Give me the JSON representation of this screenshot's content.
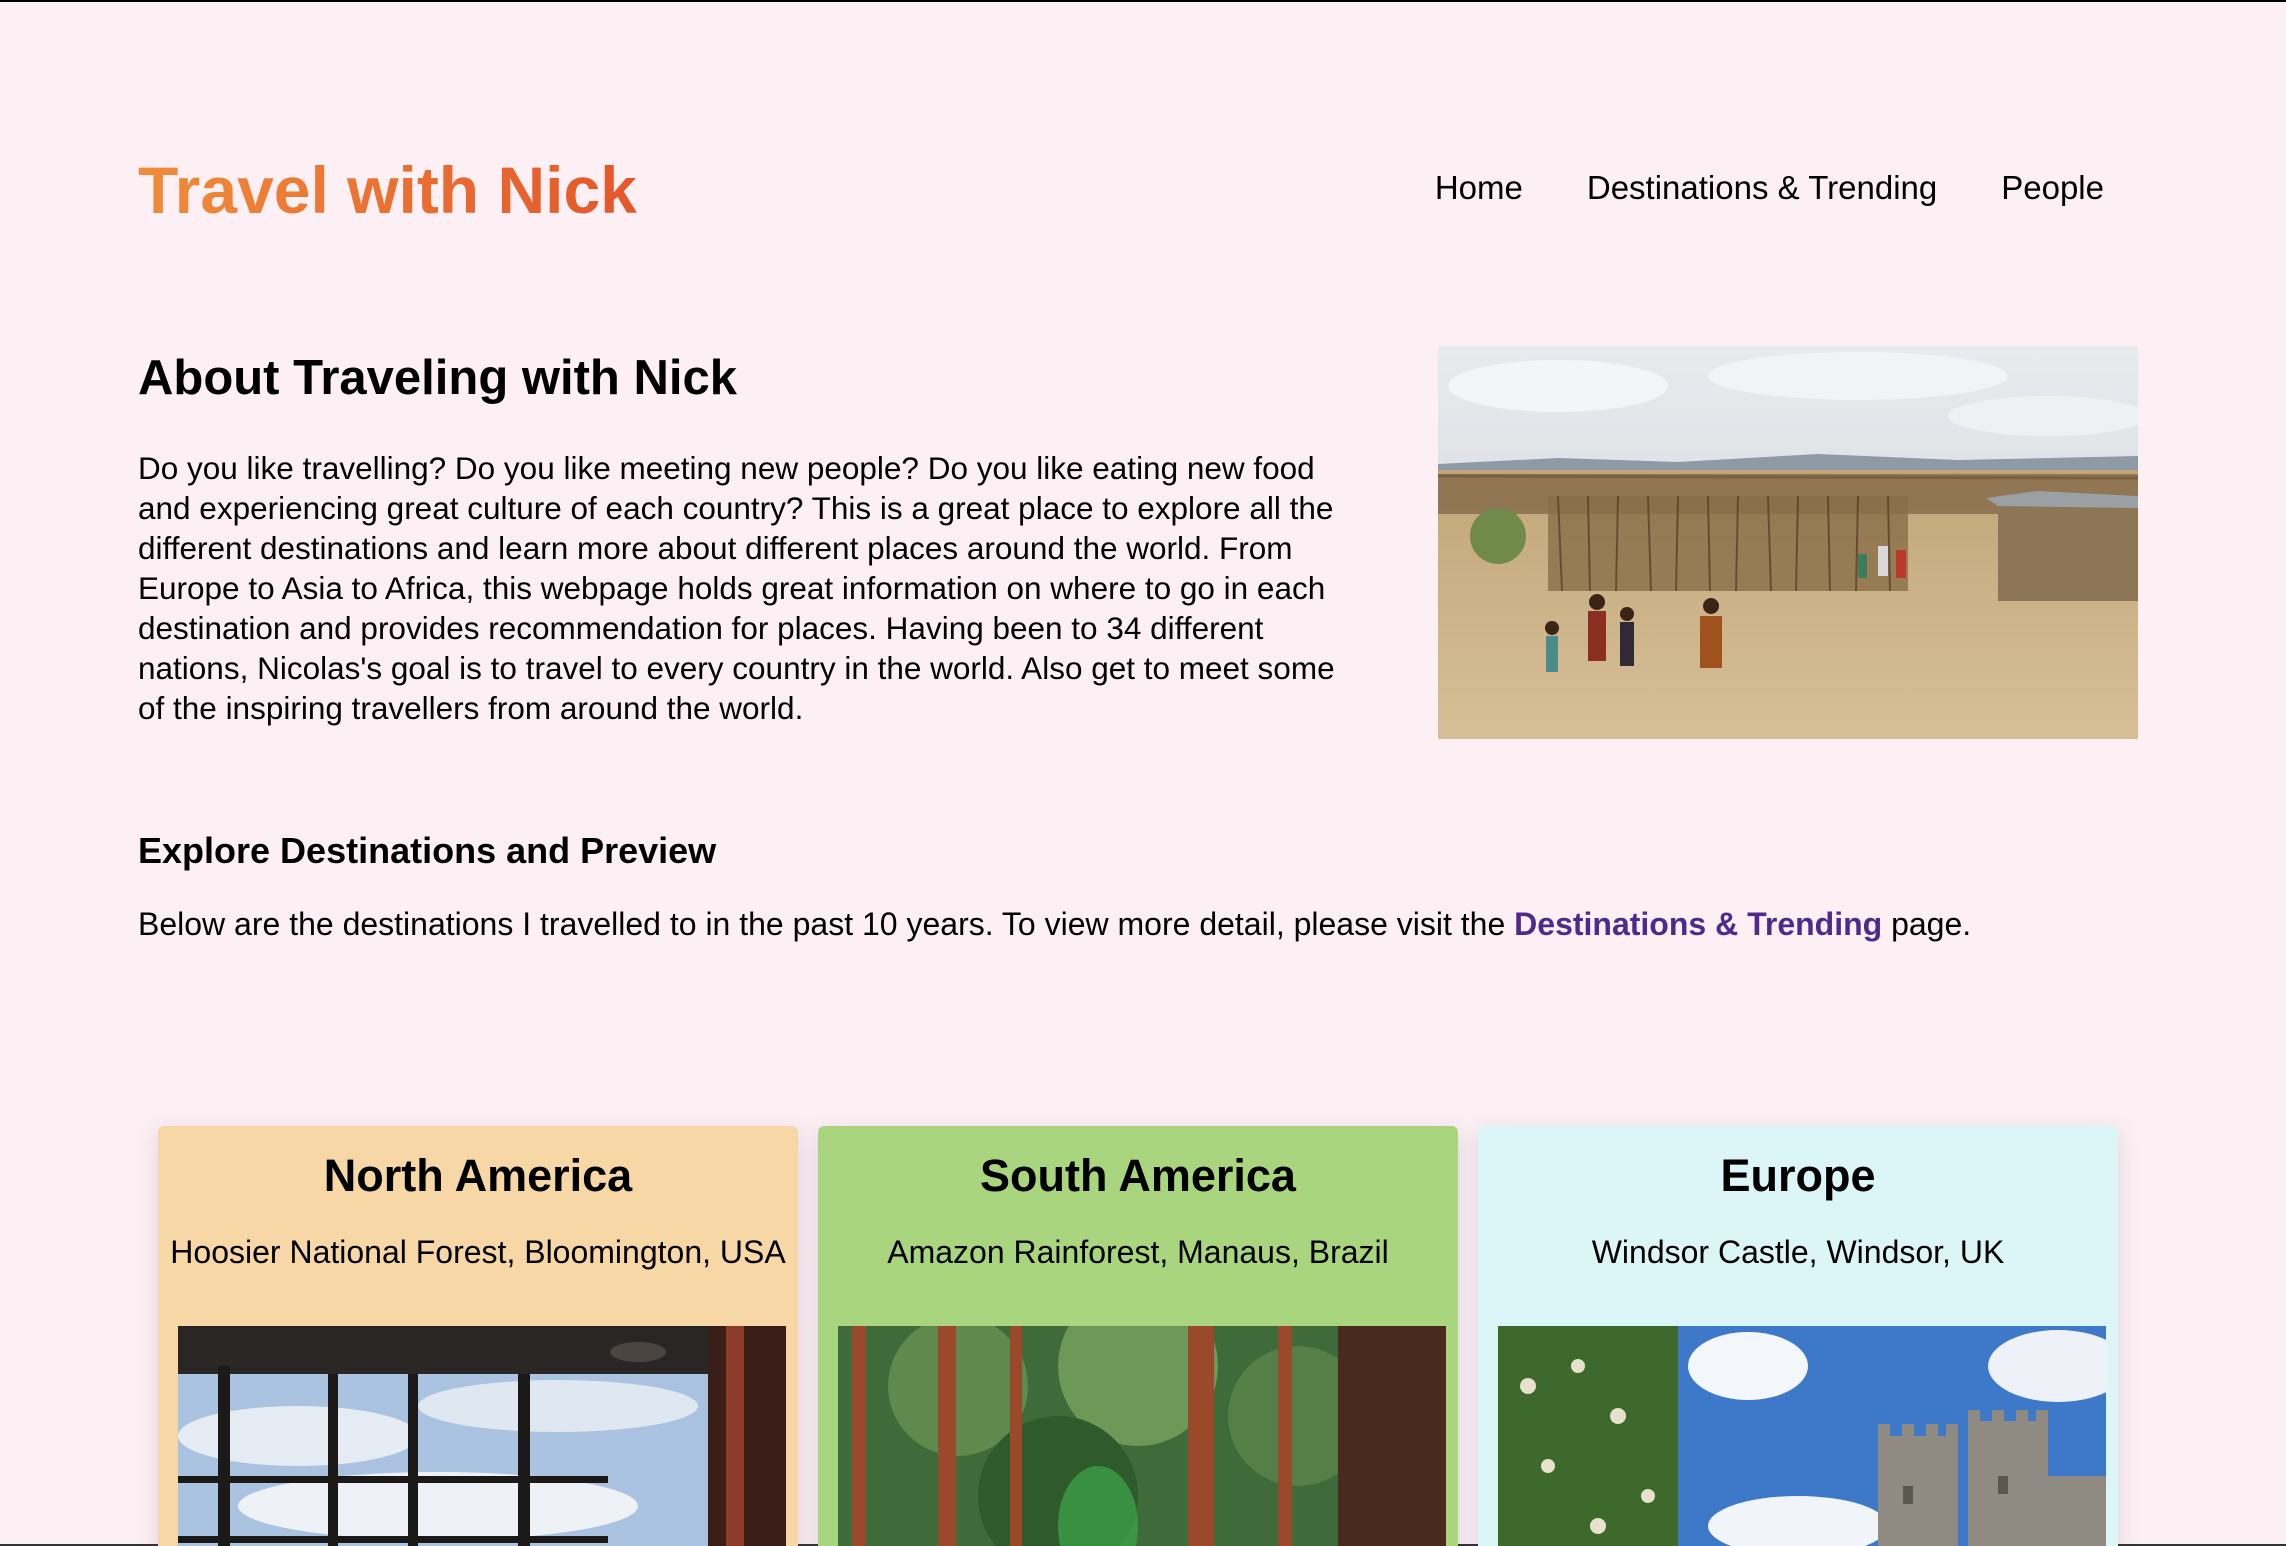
{
  "header": {
    "title": "Travel with Nick",
    "nav": [
      "Home",
      "Destinations & Trending",
      "People"
    ]
  },
  "about": {
    "title": "About Traveling with Nick",
    "text": "Do you like travelling? Do you like meeting new people? Do you like eating new food and experiencing great culture of each country? This is a great place to explore all the different destinations and learn more about different places around the world. From Europe to Asia to Africa, this webpage holds great information on where to go in each destination and provides recommendation for places. Having been to 34 different nations, Nicolas's goal is to travel to every country in the world. Also get to meet some of the inspiring travellers from around the world."
  },
  "explore": {
    "title": "Explore Destinations and Preview",
    "text_before": "Below are the destinations I travelled to in the past 10 years. To view more detail, please visit the ",
    "link_label": "Destinations & Trending",
    "text_after": " page."
  },
  "cards": [
    {
      "region": "North America",
      "location": "Hoosier National Forest, Bloomington, USA"
    },
    {
      "region": "South America",
      "location": "Amazon Rainforest, Manaus, Brazil"
    },
    {
      "region": "Europe",
      "location": "Windsor Castle, Windsor, UK"
    }
  ],
  "colors": {
    "background": "#fdf0f4",
    "title_gradient_start": "#f08c3a",
    "title_gradient_end": "#e4562a",
    "link": "#4d2a8c",
    "card_north_america": "#f7d7a6",
    "card_south_america": "#a9d57e",
    "card_europe": "#dcf5f7"
  }
}
